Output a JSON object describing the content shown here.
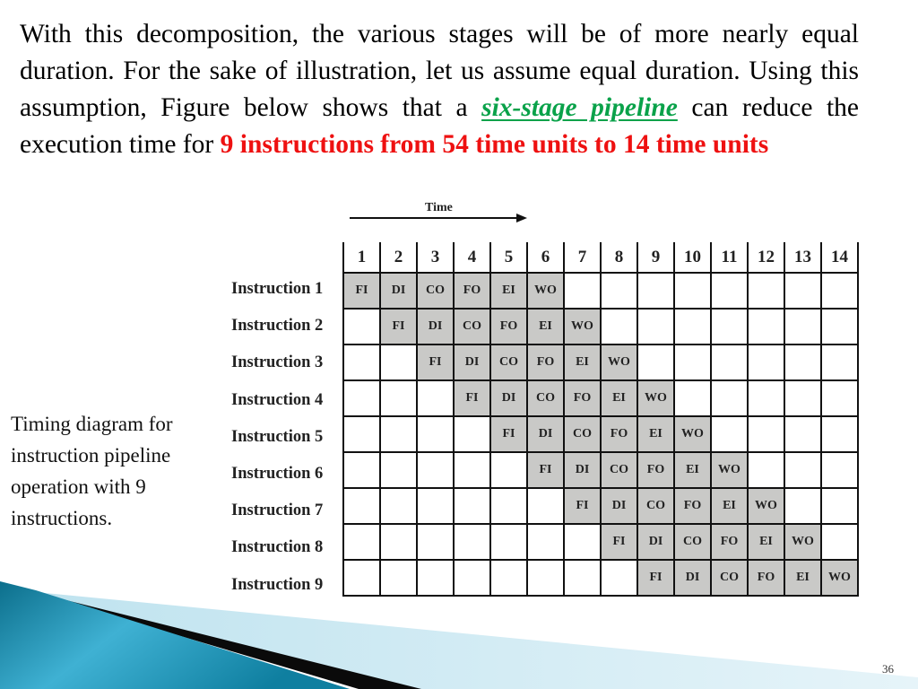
{
  "paragraph": {
    "part1": "With this decomposition, the various stages will be of more nearly equal duration. For the sake of illustration, let us assume equal duration. Using this assumption, Figure below shows that a ",
    "highlight_green": "six-stage pipeline",
    "part2": " can reduce the execution time for ",
    "highlight_red": "9 instructions from 54 time units to 14 time units"
  },
  "figure": {
    "time_axis_label": "Time",
    "columns": [
      "1",
      "2",
      "3",
      "4",
      "5",
      "6",
      "7",
      "8",
      "9",
      "10",
      "11",
      "12",
      "13",
      "14"
    ],
    "stages": [
      "FI",
      "DI",
      "CO",
      "FO",
      "EI",
      "WO"
    ],
    "rows": [
      {
        "label": "Instruction 1",
        "start": 1
      },
      {
        "label": "Instruction 2",
        "start": 2
      },
      {
        "label": "Instruction 3",
        "start": 3
      },
      {
        "label": "Instruction 4",
        "start": 4
      },
      {
        "label": "Instruction 5",
        "start": 5
      },
      {
        "label": "Instruction 6",
        "start": 6
      },
      {
        "label": "Instruction 7",
        "start": 7
      },
      {
        "label": "Instruction 8",
        "start": 8
      },
      {
        "label": "Instruction 9",
        "start": 9
      }
    ],
    "colors": {
      "active_cell": "#c9c9c7",
      "grid_line": "#111111"
    }
  },
  "caption": "Timing diagram for instruction pipeline operation with 9 instructions.",
  "page_number": "36",
  "colors": {
    "green": "#0aa24a",
    "red": "#ee1111"
  }
}
